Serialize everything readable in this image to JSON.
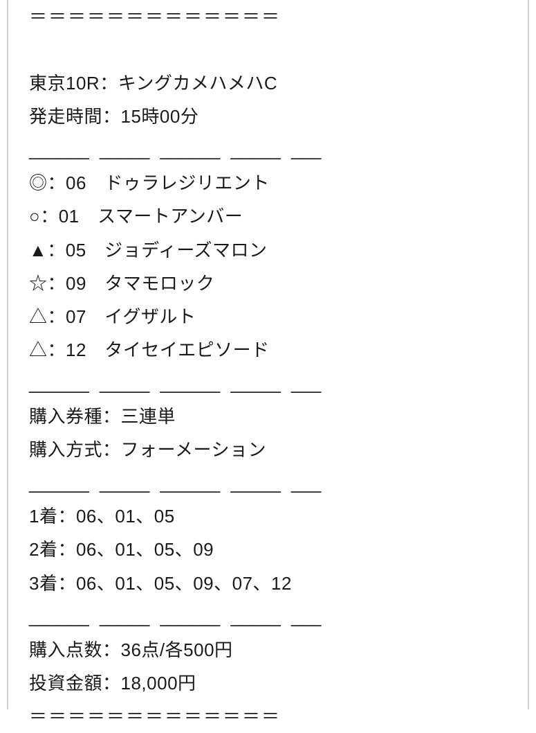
{
  "separator_top": "＝＝＝＝＝＝＝＝＝＝＝＝＝",
  "race_header": "東京10R：キングカメハメハC",
  "start_time": "発走時間：15時00分",
  "underline_sep": "______ _____ ______ _____ ___",
  "picks": [
    "◎：06　ドゥラレジリエント",
    "○：01　スマートアンバー",
    "▲：05　ジョディーズマロン",
    "☆：09　タマモロック",
    "△：07　イグザルト",
    "△：12　タイセイエピソード"
  ],
  "ticket_type": "購入券種：三連単",
  "bet_method": "購入方式：フォーメーション",
  "placing": [
    "1着：06、01、05",
    "2着：06、01、05、09",
    "3着：06、01、05、09、07、12"
  ],
  "points": "購入点数：36点/各500円",
  "total": "投資金額：18,000円",
  "separator_bottom": "＝＝＝＝＝＝＝＝＝＝＝＝＝"
}
